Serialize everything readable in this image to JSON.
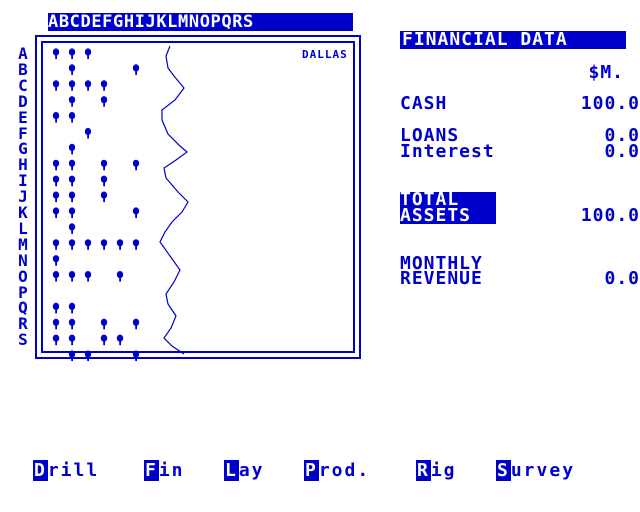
{
  "map": {
    "column_letters": "ABCDEFGHIJKLMNOPQRS",
    "row_letters": [
      "A",
      "B",
      "C",
      "D",
      "E",
      "F",
      "G",
      "H",
      "I",
      "J",
      "K",
      "L",
      "M",
      "N",
      "O",
      "P",
      "Q",
      "R",
      "S"
    ],
    "city": "DALLAS"
  },
  "financial": {
    "title": "FINANCIAL DATA",
    "unit": "$M.",
    "cash_label": "CASH",
    "cash_value": "100.0",
    "loans_label": "LOANS",
    "loans_value": "0.0",
    "interest_label": "Interest",
    "interest_value": "0.0",
    "total_assets_label_1": "TOTAL",
    "total_assets_label_2": "ASSETS",
    "total_assets_value": "100.0",
    "monthly_revenue_label_1": "MONTHLY",
    "monthly_revenue_label_2": "REVENUE",
    "monthly_revenue_value": "0.0"
  },
  "menu": [
    {
      "key": "D",
      "rest": "rill"
    },
    {
      "key": "F",
      "rest": "in"
    },
    {
      "key": "L",
      "rest": "ay"
    },
    {
      "key": "P",
      "rest": "rod."
    },
    {
      "key": "R",
      "rest": "ig"
    },
    {
      "key": "S",
      "rest": "urvey"
    }
  ],
  "colors": {
    "ink": "#0000cc",
    "paper": "#ffffff"
  },
  "icons": {
    "tree": "tree-icon"
  },
  "trees": [
    [
      0,
      0
    ],
    [
      1,
      0
    ],
    [
      2,
      0
    ],
    [
      1,
      1
    ],
    [
      5,
      1
    ],
    [
      0,
      2
    ],
    [
      1,
      2
    ],
    [
      2,
      2
    ],
    [
      3,
      2
    ],
    [
      1,
      3
    ],
    [
      3,
      3
    ],
    [
      0,
      4
    ],
    [
      1,
      4
    ],
    [
      2,
      5
    ],
    [
      1,
      6
    ],
    [
      0,
      7
    ],
    [
      1,
      7
    ],
    [
      3,
      7
    ],
    [
      5,
      7
    ],
    [
      0,
      8
    ],
    [
      1,
      8
    ],
    [
      3,
      8
    ],
    [
      0,
      9
    ],
    [
      1,
      9
    ],
    [
      3,
      9
    ],
    [
      0,
      10
    ],
    [
      1,
      10
    ],
    [
      5,
      10
    ],
    [
      1,
      11
    ],
    [
      0,
      12
    ],
    [
      1,
      12
    ],
    [
      2,
      12
    ],
    [
      3,
      12
    ],
    [
      4,
      12
    ],
    [
      5,
      12
    ],
    [
      0,
      13
    ],
    [
      0,
      14
    ],
    [
      1,
      14
    ],
    [
      2,
      14
    ],
    [
      4,
      14
    ],
    [
      0,
      16
    ],
    [
      1,
      16
    ],
    [
      0,
      17
    ],
    [
      1,
      17
    ],
    [
      3,
      17
    ],
    [
      5,
      17
    ],
    [
      0,
      18
    ],
    [
      1,
      18
    ],
    [
      3,
      18
    ],
    [
      4,
      18
    ],
    [
      1,
      19
    ],
    [
      2,
      19
    ],
    [
      5,
      19
    ]
  ]
}
